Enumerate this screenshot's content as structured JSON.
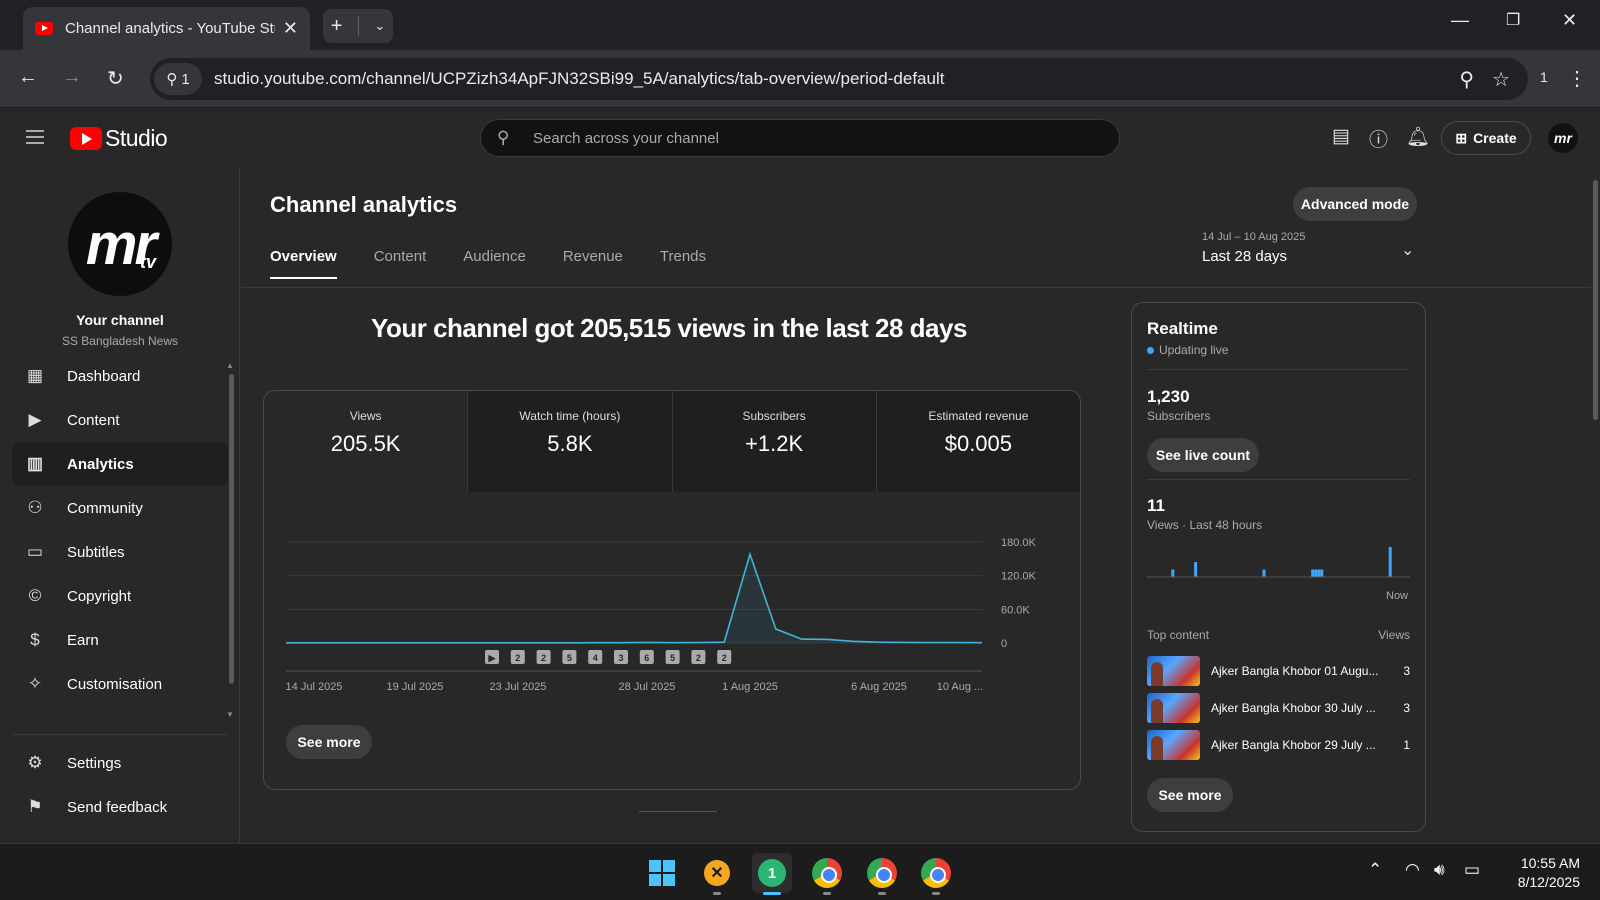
{
  "browser": {
    "tab_title": "Channel analytics - YouTube Studio",
    "url": "studio.youtube.com/channel/UCPZizh34ApFJN32SBi99_5A/analytics/tab-overview/period-default",
    "site_info_count": "1",
    "extension_count": "1"
  },
  "header": {
    "logo_text": "Studio",
    "search_placeholder": "Search across your channel",
    "create_label": "Create",
    "avatar_text": "mr"
  },
  "channel": {
    "avatar_main": "mr",
    "avatar_sub": "tv",
    "title": "Your channel",
    "name": "SS Bangladesh News"
  },
  "sidebar": {
    "items": [
      {
        "label": "Dashboard",
        "icon": "dashboard-icon"
      },
      {
        "label": "Content",
        "icon": "content-icon"
      },
      {
        "label": "Analytics",
        "icon": "analytics-icon"
      },
      {
        "label": "Community",
        "icon": "community-icon"
      },
      {
        "label": "Subtitles",
        "icon": "subtitles-icon"
      },
      {
        "label": "Copyright",
        "icon": "copyright-icon"
      },
      {
        "label": "Earn",
        "icon": "dollar-icon"
      },
      {
        "label": "Customisation",
        "icon": "wand-icon"
      }
    ],
    "bottom_items": [
      {
        "label": "Settings",
        "icon": "gear-icon"
      },
      {
        "label": "Send feedback",
        "icon": "feedback-icon"
      }
    ]
  },
  "main": {
    "title": "Channel analytics",
    "advanced_mode_label": "Advanced mode",
    "tabs": [
      {
        "label": "Overview"
      },
      {
        "label": "Content"
      },
      {
        "label": "Audience"
      },
      {
        "label": "Revenue"
      },
      {
        "label": "Trends"
      }
    ],
    "period_range": "14 Jul – 10 Aug 2025",
    "period_label": "Last 28 days",
    "headline": "Your channel got 205,515 views in the last 28 days",
    "metrics": [
      {
        "label": "Views",
        "value": "205.5K"
      },
      {
        "label": "Watch time (hours)",
        "value": "5.8K"
      },
      {
        "label": "Subscribers",
        "value": "+1.2K"
      },
      {
        "label": "Estimated revenue",
        "value": "$0.005"
      }
    ],
    "see_more_label": "See more"
  },
  "chart_data": {
    "type": "line",
    "title": "",
    "xlabel": "",
    "ylabel": "",
    "x_tick_labels": [
      "14 Jul 2025",
      "19 Jul 2025",
      "23 Jul 2025",
      "28 Jul 2025",
      "1 Aug 2025",
      "6 Aug 2025",
      "10 Aug ..."
    ],
    "y_tick_labels": [
      "180.0K",
      "120.0K",
      "60.0K",
      "0"
    ],
    "ylim": [
      0,
      180000
    ],
    "series": [
      {
        "values": [
          400,
          400,
          400,
          400,
          400,
          400,
          400,
          400,
          400,
          400,
          400,
          400,
          500,
          600,
          1000,
          600,
          800,
          1500,
          158000,
          25000,
          7000,
          6500,
          3000,
          1500,
          1000,
          800,
          700,
          500
        ]
      }
    ],
    "publish_markers": [
      "▶",
      "2",
      "2",
      "5",
      "4",
      "3",
      "6",
      "5",
      "2",
      "2"
    ],
    "color": "#41b4d9"
  },
  "realtime": {
    "title": "Realtime",
    "live_label": "Updating live",
    "subscribers_value": "1,230",
    "subscribers_label": "Subscribers",
    "see_live_label": "See live count",
    "views_value": "11",
    "views_label": "Views · Last 48 hours",
    "now_label": "Now",
    "bars": [
      0,
      0,
      0,
      0,
      0,
      0,
      0,
      0,
      0,
      0,
      0,
      0,
      0,
      0,
      0,
      0,
      1,
      0,
      0,
      0,
      0,
      0,
      0,
      0,
      0,
      0,
      0,
      0,
      0,
      0,
      0,
      2,
      0,
      0,
      0,
      0,
      0,
      0,
      0,
      0,
      0,
      0,
      0,
      0,
      0,
      0,
      0,
      0,
      0,
      0,
      0,
      0,
      0,
      0,
      0,
      0,
      0,
      0,
      0,
      0,
      0,
      0,
      0,
      0,
      0,
      0,
      0,
      0,
      0,
      0,
      0,
      0,
      0,
      0,
      0,
      0,
      1,
      0,
      0,
      0,
      0,
      0,
      0,
      0,
      0,
      0,
      0,
      0,
      0,
      0,
      0,
      0,
      0,
      0,
      0,
      0,
      0,
      0,
      0,
      0,
      0,
      0,
      0,
      0,
      0,
      0,
      0,
      0,
      1,
      0,
      1,
      0,
      1,
      0,
      1,
      0,
      0,
      0,
      0,
      0,
      0,
      0,
      0,
      0,
      0,
      0,
      0,
      0,
      0,
      0,
      0,
      0,
      0,
      0,
      0,
      0,
      0,
      0,
      0,
      0,
      0,
      0,
      0,
      0,
      0,
      0,
      0,
      0,
      0,
      0,
      0,
      0,
      0,
      0,
      0,
      0,
      0,
      0,
      0,
      4,
      0,
      0,
      0,
      0,
      0,
      0,
      0,
      0,
      0,
      0,
      0,
      0,
      0
    ],
    "top_content_label": "Top content",
    "views_col_label": "Views",
    "top_content": [
      {
        "title": "Ajker Bangla Khobor 01 Augu...",
        "views": "3"
      },
      {
        "title": "Ajker Bangla Khobor 30 July ...",
        "views": "3"
      },
      {
        "title": "Ajker Bangla Khobor 29 July ...",
        "views": "1"
      }
    ],
    "see_more_label": "See more",
    "accent": "#3ea6ff"
  },
  "taskbar": {
    "time": "10:55 AM",
    "date": "8/12/2025",
    "active_app_badge": "1"
  }
}
